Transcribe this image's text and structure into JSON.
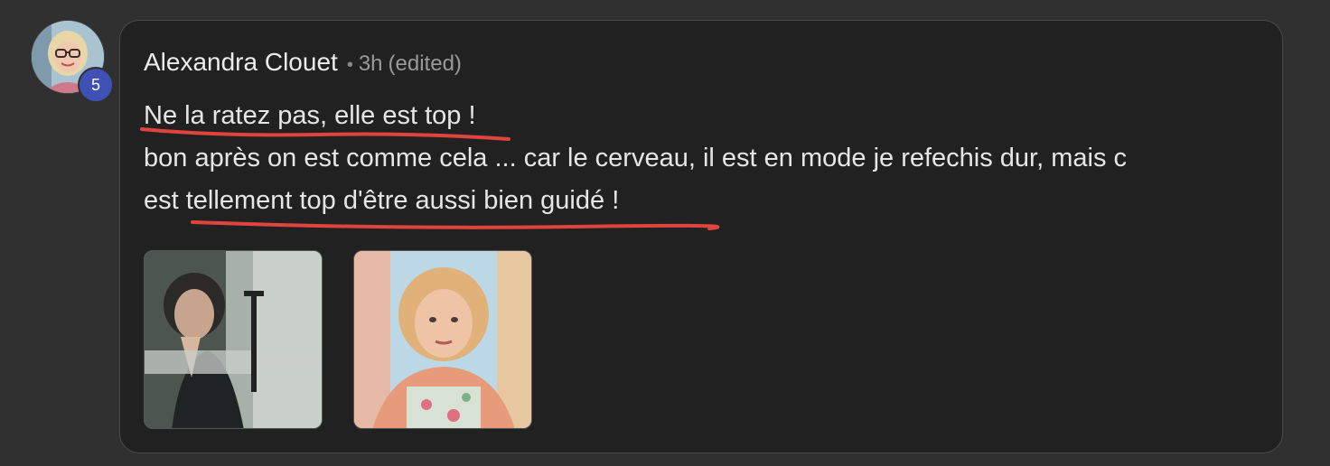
{
  "comment": {
    "avatar_icon": "user-avatar",
    "level_badge": "5",
    "author": "Alexandra Clouet",
    "separator": "•",
    "time": "3h",
    "edited": "(edited)",
    "lines": [
      "Ne la ratez pas, elle est top !",
      "bon après on est comme cela ... car le cerveau, il est en mode je refechis dur, mais c",
      "est tellement top d'être aussi bien guidé !"
    ],
    "attachments": [
      {
        "icon": "gif-thumbnail-man"
      },
      {
        "icon": "gif-thumbnail-woman"
      }
    ]
  },
  "colors": {
    "page_bg": "#303030",
    "card_bg": "#212121",
    "badge": "#3f51b5",
    "annotation": "#e0443e"
  }
}
